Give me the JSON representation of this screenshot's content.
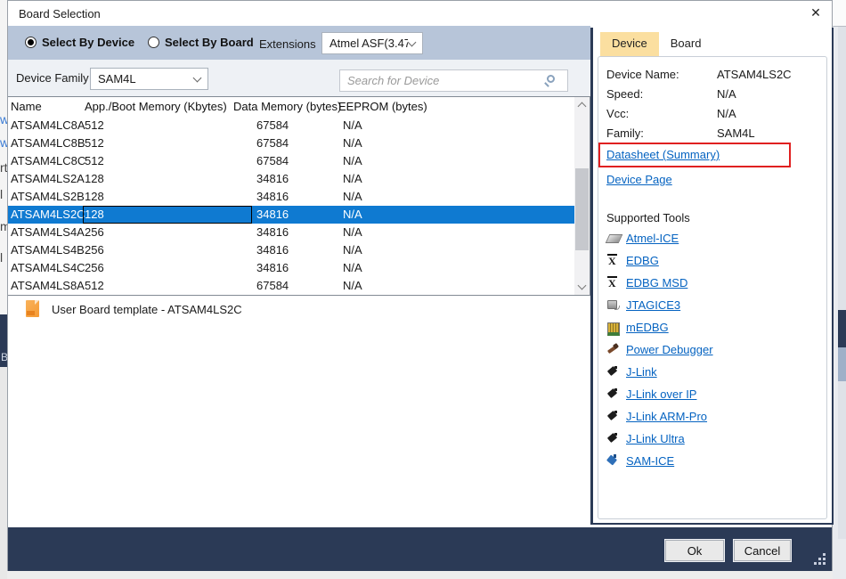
{
  "dialog": {
    "title": "Board Selection",
    "close_glyph": "✕"
  },
  "toolbar": {
    "select_by_device": "Select By Device",
    "select_by_board": "Select By Board",
    "extensions_label": "Extensions",
    "extensions_value": "Atmel ASF(3.47."
  },
  "filter": {
    "family_label": "Device Family",
    "family_value": "SAM4L",
    "search_placeholder": "Search for Device"
  },
  "table": {
    "columns": [
      "Name",
      "App./Boot Memory (Kbytes)",
      "Data Memory (bytes)",
      "EEPROM (bytes)"
    ],
    "rows": [
      {
        "name": "ATSAM4LC8A",
        "app_boot": "512",
        "data_mem": "67584",
        "eeprom": "N/A",
        "selected": false
      },
      {
        "name": "ATSAM4LC8B",
        "app_boot": "512",
        "data_mem": "67584",
        "eeprom": "N/A",
        "selected": false
      },
      {
        "name": "ATSAM4LC8C",
        "app_boot": "512",
        "data_mem": "67584",
        "eeprom": "N/A",
        "selected": false
      },
      {
        "name": "ATSAM4LS2A",
        "app_boot": "128",
        "data_mem": "34816",
        "eeprom": "N/A",
        "selected": false
      },
      {
        "name": "ATSAM4LS2B",
        "app_boot": "128",
        "data_mem": "34816",
        "eeprom": "N/A",
        "selected": false
      },
      {
        "name": "ATSAM4LS2C",
        "app_boot": "128",
        "data_mem": "34816",
        "eeprom": "N/A",
        "selected": true
      },
      {
        "name": "ATSAM4LS4A",
        "app_boot": "256",
        "data_mem": "34816",
        "eeprom": "N/A",
        "selected": false
      },
      {
        "name": "ATSAM4LS4B",
        "app_boot": "256",
        "data_mem": "34816",
        "eeprom": "N/A",
        "selected": false
      },
      {
        "name": "ATSAM4LS4C",
        "app_boot": "256",
        "data_mem": "34816",
        "eeprom": "N/A",
        "selected": false
      },
      {
        "name": "ATSAM4LS8A",
        "app_boot": "512",
        "data_mem": "67584",
        "eeprom": "N/A",
        "selected": false
      }
    ]
  },
  "template_note": {
    "label": "User Board template - ATSAM4LS2C"
  },
  "panel": {
    "tabs": [
      {
        "label": "Device",
        "active": true
      },
      {
        "label": "Board",
        "active": false
      }
    ],
    "fields": [
      {
        "label": "Device Name:",
        "value": "ATSAM4LS2C"
      },
      {
        "label": "Speed:",
        "value": "N/A"
      },
      {
        "label": "Vcc:",
        "value": "N/A"
      },
      {
        "label": "Family:",
        "value": "SAM4L"
      }
    ],
    "datasheet_link": "Datasheet (Summary)",
    "device_page_link": "Device Page",
    "tools_heading": "Supported Tools",
    "tools": [
      {
        "label": "Atmel-ICE",
        "icon": "atmel-ice-icon"
      },
      {
        "label": "EDBG",
        "icon": "edbg-icon"
      },
      {
        "label": "EDBG MSD",
        "icon": "edbg-msd-icon"
      },
      {
        "label": "JTAGICE3",
        "icon": "jtagice3-icon"
      },
      {
        "label": "mEDBG",
        "icon": "medbg-icon"
      },
      {
        "label": "Power Debugger",
        "icon": "power-debugger-icon"
      },
      {
        "label": "J-Link",
        "icon": "jlink-icon"
      },
      {
        "label": "J-Link over IP",
        "icon": "jlink-over-ip-icon"
      },
      {
        "label": "J-Link ARM-Pro",
        "icon": "jlink-arm-pro-icon"
      },
      {
        "label": "J-Link Ultra",
        "icon": "jlink-ultra-icon"
      },
      {
        "label": "SAM-ICE",
        "icon": "sam-ice-icon"
      }
    ]
  },
  "footer": {
    "ok": "Ok",
    "cancel": "Cancel"
  },
  "colors": {
    "selection_blue": "#0f7ad1",
    "navy": "#2b3a56",
    "toolbar_blue": "#b7c5d9",
    "tab_active_yellow": "#fbdfa0",
    "link_blue": "#0563c1",
    "annotation_red": "#e02020"
  },
  "background_fragments": {
    "left_glyphs": [
      "w",
      "w",
      "rt",
      "l",
      "m",
      "l"
    ],
    "left_navy_glyph": "B"
  }
}
